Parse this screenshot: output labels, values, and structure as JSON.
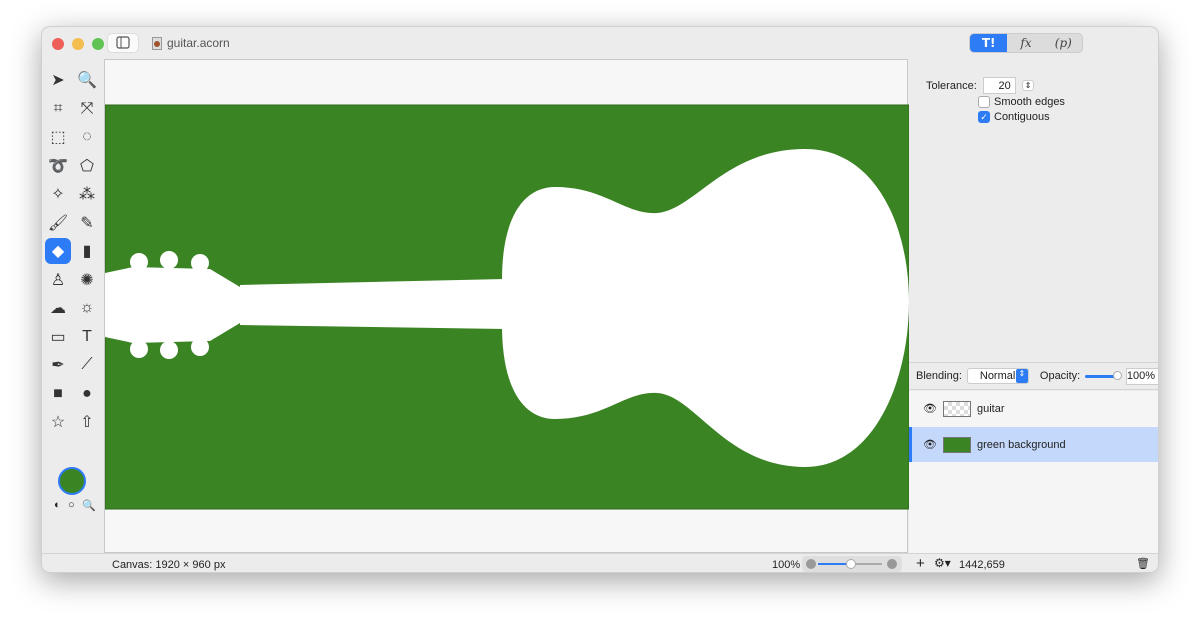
{
  "window": {
    "title": "guitar.acorn"
  },
  "toolbar": {
    "segments": [
      {
        "label": "T!",
        "icon": "tools-icon"
      },
      {
        "label": "fx",
        "icon": "effects-icon"
      },
      {
        "label": "(p)",
        "icon": "properties-icon"
      }
    ]
  },
  "tools": [
    "select-arrow",
    "zoom",
    "crop",
    "transform",
    "rect-select",
    "ellipse-select",
    "lasso",
    "polygon-lasso",
    "magic-wand",
    "color-select",
    "brush",
    "pencil",
    "paint-bucket",
    "eraser",
    "clone-stamp",
    "smudge",
    "burn",
    "dodge-sun",
    "gradient",
    "text",
    "pen",
    "line",
    "rectangle",
    "ellipse",
    "star",
    "arrow"
  ],
  "colors": {
    "foreground": "#3b8424",
    "accent": "#2d7cf6",
    "canvas_green": "#3b8424"
  },
  "options": {
    "tolerance_label": "Tolerance:",
    "tolerance": "20",
    "smooth_edges": "Smooth edges",
    "smooth_edges_checked": false,
    "contiguous": "Contiguous",
    "contiguous_checked": true
  },
  "layers_bar": {
    "blending_label": "Blending:",
    "blending": "Normal",
    "opacity_label": "Opacity:",
    "opacity": "100%",
    "opacity_value": 100
  },
  "layers": [
    {
      "name": "guitar",
      "selected": false
    },
    {
      "name": "green background",
      "selected": true
    }
  ],
  "status": {
    "canvas": "Canvas: 1920 × 960 px",
    "zoom": "100%",
    "zoom_value": 100,
    "coords": "1442,659"
  }
}
